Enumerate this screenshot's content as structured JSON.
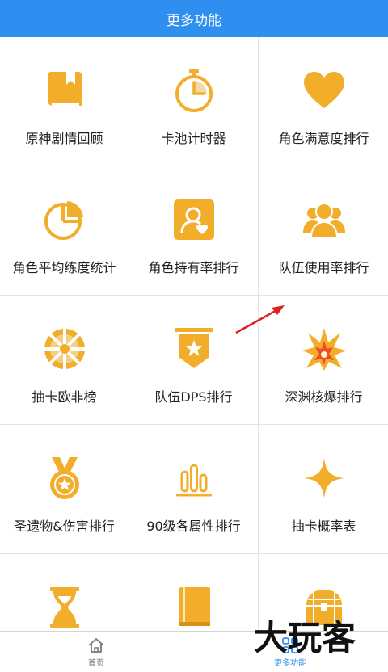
{
  "header": {
    "title": "更多功能"
  },
  "features": [
    {
      "label": "原神剧情回顾",
      "icon": "book-icon"
    },
    {
      "label": "卡池计时器",
      "icon": "stopwatch-icon"
    },
    {
      "label": "角色满意度排行",
      "icon": "heart-icon"
    },
    {
      "label": "角色平均练度统计",
      "icon": "pie-chart-icon"
    },
    {
      "label": "角色持有率排行",
      "icon": "user-card-icon"
    },
    {
      "label": "队伍使用率排行",
      "icon": "group-icon"
    },
    {
      "label": "抽卡欧非榜",
      "icon": "wheel-icon"
    },
    {
      "label": "队伍DPS排行",
      "icon": "star-banner-icon"
    },
    {
      "label": "深渊核爆排行",
      "icon": "explosion-icon"
    },
    {
      "label": "圣遗物&伤害排行",
      "icon": "medal-icon"
    },
    {
      "label": "90级各属性排行",
      "icon": "bar-chart-icon"
    },
    {
      "label": "抽卡概率表",
      "icon": "sparkle-icon"
    },
    {
      "label": "",
      "icon": "hourglass-icon"
    },
    {
      "label": "",
      "icon": "notebook-icon"
    },
    {
      "label": "",
      "icon": "treasure-chest-icon"
    }
  ],
  "bottom_nav": {
    "home_label": "首页",
    "more_label": "更多功能"
  },
  "watermark": {
    "text": "大玩客"
  },
  "colors": {
    "accent": "#2f8ff0",
    "icon": "#f2ad2b",
    "annotation_arrow": "#e02020"
  }
}
